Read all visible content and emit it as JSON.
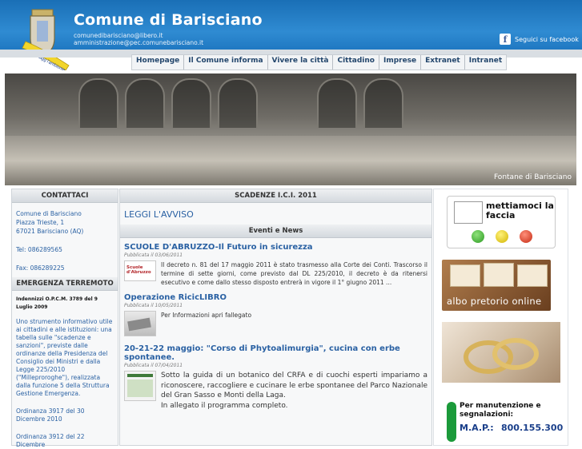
{
  "header": {
    "title": "Comune di Barisciano",
    "email1": "comunedibarisciano@libero.it",
    "email2": "amministrazione@pec.comunebarisciano.it",
    "facebook_label": "Seguici su facebook",
    "crest_ribbon_text": "IO protagg l'ambiente"
  },
  "nav": {
    "items": [
      "Homepage",
      "Il Comune informa",
      "Vivere la città",
      "Cittadino",
      "Imprese",
      "Extranet",
      "Intranet"
    ]
  },
  "banner": {
    "caption": "Fontane di Barisciano"
  },
  "left": {
    "contacts_title": "CONTATTACI",
    "contacts": {
      "line1": "Comune di Barisciano",
      "line2": "Piazza Trieste, 1",
      "line3": "67021 Barisciano (AQ)",
      "tel": "Tel: 086289565",
      "fax": "Fax: 086289225"
    },
    "emergency_title": "EMERGENZA TERREMOTO",
    "emergency": {
      "subtitle": "Indennizzi O.P.C.M. 3789 del 9 Luglio 2009",
      "text": "Uno strumento informativo utile ai cittadini e alle istituzioni: una tabella sulle \"scadenze e sanzioni\", previste dalle ordinanze della Presidenza del Consiglio dei Ministri e dalla Legge 225/2010 (\"Milleproroghe\"), realizzata dalla funzione 5 della Struttura Gestione Emergenza.",
      "ord1": "Ordinanza 3917 del 30 Dicembre 2010",
      "ord2": "Ordinanza 3912 del 22 Dicembre"
    }
  },
  "center": {
    "scadenze_title": "SCADENZE I.C.I. 2011",
    "leggi": "LEGGI L'AVVISO",
    "news_title": "Eventi e News",
    "news": [
      {
        "title": "SCUOLE D'ABRUZZO-Il Futuro in sicurezza",
        "published": "Pubblicata il 03/06/2011",
        "text": "Il decreto n. 81 del 17 maggio 2011 è stato trasmesso alla Corte dei Conti. Trascorso il termine di sette giorni, come previsto dal DL 225/2010, il decreto è da ritenersi esecutivo e come dallo stesso disposto entrerà in vigore il 1° giugno 2011 ...",
        "thumb_label": "Scuole d'Abruzzo"
      },
      {
        "title": "Operazione RicicLIBRO",
        "published": "Pubblicata il 10/05/2011",
        "text": "Per Informazioni apri fallegato"
      },
      {
        "title": "20-21-22 maggio: \"Corso di Phytoalimurgia\", cucina con erbe spontanee.",
        "published": "Pubblicata il 07/04/2011",
        "text1": "Sotto la guida di un botanico del CRFA e di cuochi esperti impariamo a riconoscere, raccogliere e cucinare le erbe spontanee del Parco Nazionale del Gran Sasso e Monti della Laga.",
        "text2": "In allegato il programma completo."
      }
    ]
  },
  "right": {
    "mettiamo": "mettiamoci la faccia",
    "albo": "albo pretorio online",
    "manut_title": "Per manutenzione e segnalazioni:",
    "manut_map": "M.A.P.:",
    "manut_phone": "800.155.300"
  },
  "colors": {
    "header_blue": "#2f8bd2",
    "link_blue": "#2a61a3",
    "nav_text": "#24476d"
  }
}
